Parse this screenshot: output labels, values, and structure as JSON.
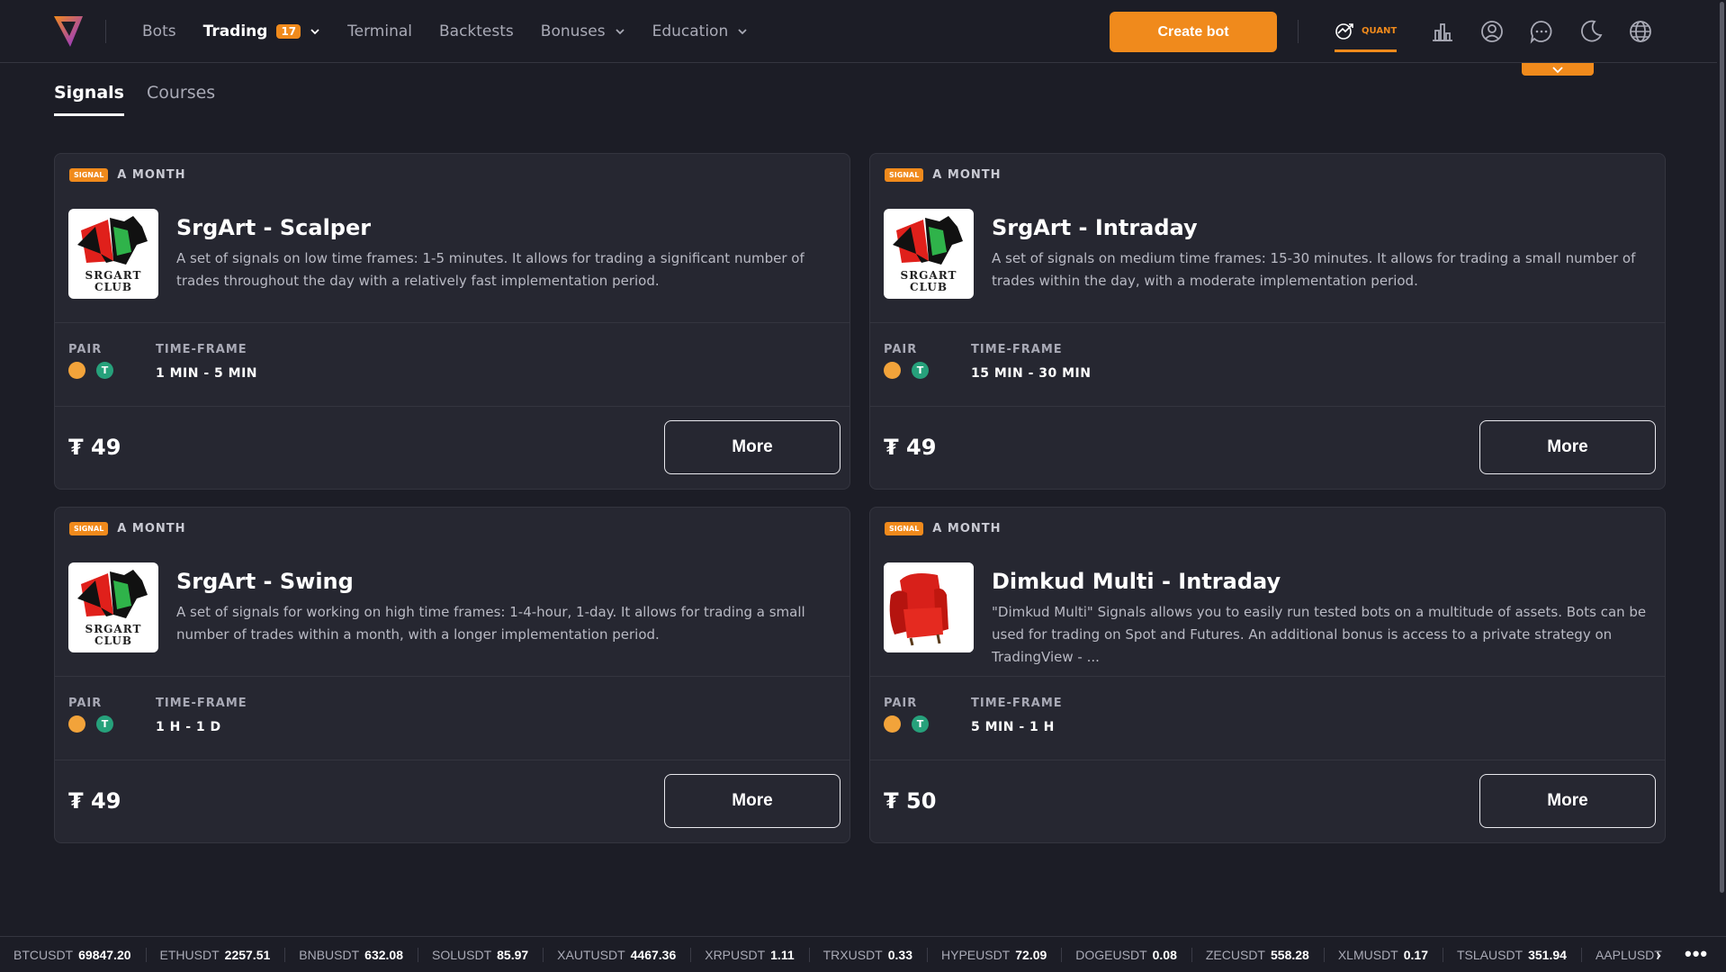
{
  "nav": {
    "items": [
      {
        "label": "Bots",
        "active": false
      },
      {
        "label": "Trading",
        "active": true,
        "badge": "17",
        "dropdown": true
      },
      {
        "label": "Terminal",
        "active": false
      },
      {
        "label": "Backtests",
        "active": false
      },
      {
        "label": "Bonuses",
        "active": false,
        "dropdown": true
      },
      {
        "label": "Education",
        "active": false,
        "dropdown": true
      }
    ],
    "create_label": "Create bot",
    "quant_label": "QUANT"
  },
  "tabs": [
    {
      "label": "Signals",
      "active": true
    },
    {
      "label": "Courses",
      "active": false
    }
  ],
  "cards": [
    {
      "tag": "SIGNAL",
      "period": "A MONTH",
      "title": "SrgArt - Scalper",
      "description": "A set of signals on low time frames: 1-5 minutes. It allows for trading a significant number of trades throughout the day with a relatively fast implementation period.",
      "logo_text_1": "SRGART",
      "logo_text_2": "CLUB",
      "pair_label": "PAIR",
      "timeframe_label": "TIME-FRAME",
      "timeframe": "1 MIN - 5 MIN",
      "price": "₮ 49",
      "more_label": "More"
    },
    {
      "tag": "SIGNAL",
      "period": "A MONTH",
      "title": "SrgArt - Intraday",
      "description": "A set of signals on medium time frames: 15-30 minutes. It allows for trading a small number of trades within the day, with a moderate implementation period.",
      "logo_text_1": "SRGART",
      "logo_text_2": "CLUB",
      "pair_label": "PAIR",
      "timeframe_label": "TIME-FRAME",
      "timeframe": "15 MIN - 30 MIN",
      "price": "₮ 49",
      "more_label": "More"
    },
    {
      "tag": "SIGNAL",
      "period": "A MONTH",
      "title": "SrgArt - Swing",
      "description": "A set of signals for working on high time frames: 1-4-hour, 1-day. It allows for trading a small number of trades within a month, with a longer implementation period.",
      "logo_text_1": "SRGART",
      "logo_text_2": "CLUB",
      "pair_label": "PAIR",
      "timeframe_label": "TIME-FRAME",
      "timeframe": "1 H - 1 D",
      "price": "₮ 49",
      "more_label": "More"
    },
    {
      "tag": "SIGNAL",
      "period": "A MONTH",
      "title": "Dimkud Multi - Intraday",
      "description": "\"Dimkud Multi\" Signals allows you to easily run tested bots on a multitude of assets. Bots can be used for trading on Spot and Futures. An additional bonus is access to a private strategy on TradingView - ...",
      "pair_label": "PAIR",
      "timeframe_label": "TIME-FRAME",
      "timeframe": "5 MIN - 1 H",
      "price": "₮ 50",
      "more_label": "More"
    }
  ],
  "ticker": [
    {
      "symbol": "BTCUSDT",
      "value": "69847.20"
    },
    {
      "symbol": "ETHUSDT",
      "value": "2257.51"
    },
    {
      "symbol": "BNBUSDT",
      "value": "632.08"
    },
    {
      "symbol": "SOLUSDT",
      "value": "85.97"
    },
    {
      "symbol": "XAUTUSDT",
      "value": "4467.36"
    },
    {
      "symbol": "XRPUSDT",
      "value": "1.11"
    },
    {
      "symbol": "TRXUSDT",
      "value": "0.33"
    },
    {
      "symbol": "HYPEUSDT",
      "value": "72.09"
    },
    {
      "symbol": "DOGEUSDT",
      "value": "0.08"
    },
    {
      "symbol": "ZECUSDT",
      "value": "558.28"
    },
    {
      "symbol": "XLMUSDT",
      "value": "0.17"
    },
    {
      "symbol": "TSLAUSDT",
      "value": "351.94"
    },
    {
      "symbol": "AAPLUSDT",
      "value": ""
    }
  ],
  "colors": {
    "accent": "#f08a1c",
    "background": "#1c1d26",
    "card": "#262731",
    "tether_green": "#26a17b",
    "btc_orange": "#f2a33a"
  },
  "icons": [
    "logo-icon",
    "chevron-down-icon",
    "quant-chart-icon",
    "bar-chart-icon",
    "user-icon",
    "chat-icon",
    "moon-icon",
    "globe-icon",
    "chevron-right-icon",
    "more-dots-icon"
  ]
}
